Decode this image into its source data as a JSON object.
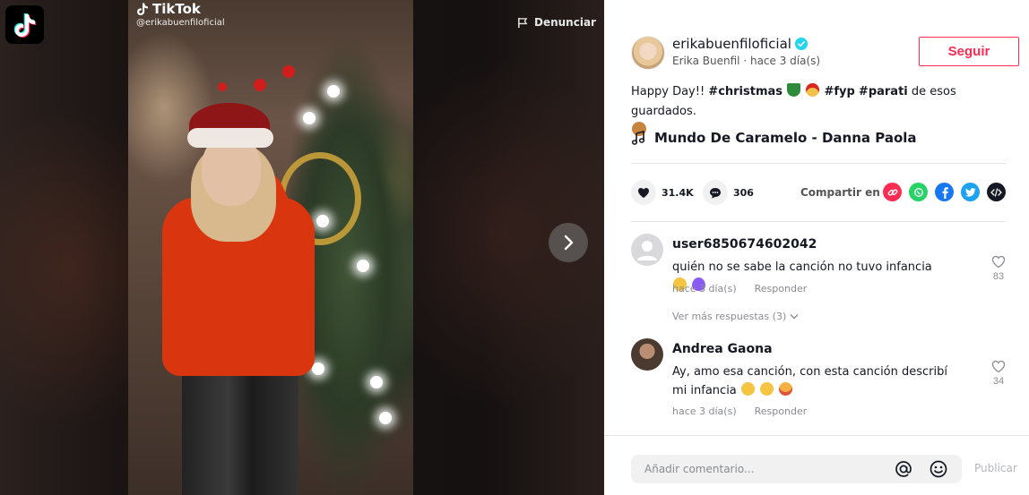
{
  "video": {
    "watermark_brand": "TikTok",
    "watermark_handle": "@erikabuenfiloficial",
    "report_label": "Denunciar"
  },
  "author": {
    "username": "erikabuenfiloficial",
    "verified": true,
    "display_name": "Erika Buenfil",
    "separator": "·",
    "posted": "hace 3 día(s)",
    "follow_label": "Seguir"
  },
  "caption": {
    "lead": "Happy Day!! ",
    "tags": [
      "#christmas",
      "#fyp",
      "#parati"
    ],
    "trailing": " de esos guardados."
  },
  "music": {
    "title": "Mundo De Caramelo - Danna Paola"
  },
  "stats": {
    "likes": "31.4K",
    "comments": "306",
    "share_label": "Compartir en"
  },
  "share_targets": [
    "link-icon",
    "whatsapp-icon",
    "facebook-icon",
    "twitter-icon",
    "embed-icon"
  ],
  "colors": {
    "brand_red": "#fe2c55",
    "verified_blue": "#20d5ec",
    "whatsapp": "#25d366",
    "facebook": "#1877f2",
    "twitter": "#1da1f2"
  },
  "comments": [
    {
      "user": "user6850674602042",
      "text": "quién no se sabe la canción no tuvo infancia",
      "time": "hace 3 día(s)",
      "reply_label": "Responder",
      "likes": "83"
    },
    {
      "user": "Andrea Gaona",
      "text": "Ay, amo esa canción, con esta canción describí mi infancia",
      "time": "hace 3 día(s)",
      "reply_label": "Responder",
      "likes": "34"
    }
  ],
  "view_replies_label": "Ver más respuestas (3)",
  "composer": {
    "placeholder": "Añadir comentario...",
    "post_label": "Publicar"
  }
}
